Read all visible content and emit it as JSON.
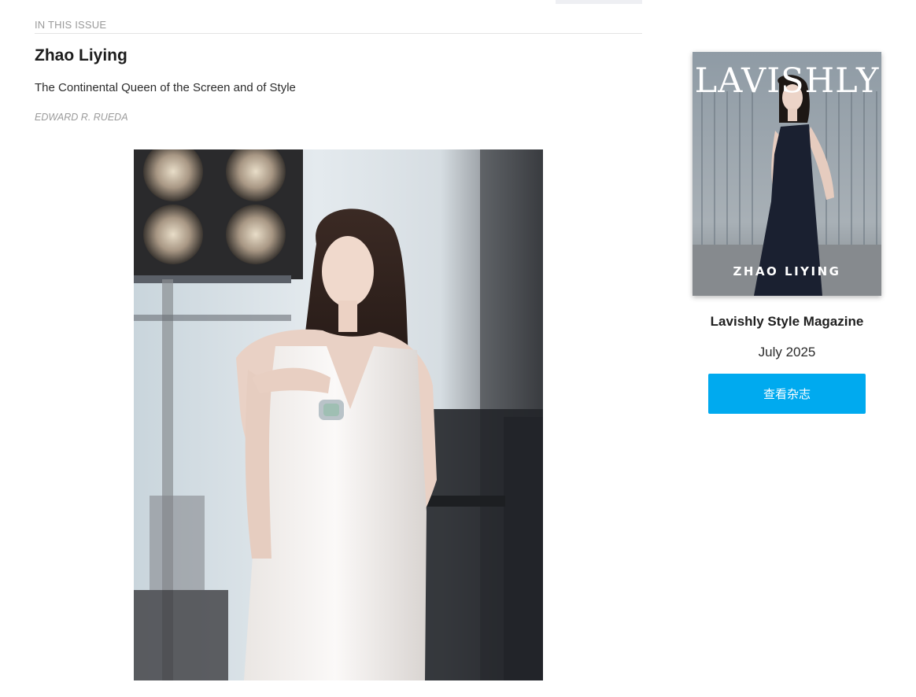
{
  "article": {
    "section_label": "IN THIS ISSUE",
    "title": "Zhao Liying",
    "subtitle": "The Continental Queen of the Screen and of Style",
    "author": "EDWARD R. RUEDA"
  },
  "sidebar": {
    "cover": {
      "masthead": "LAVISHLY",
      "cover_name": "ZHAO LIYING"
    },
    "magazine_title": "Lavishly Style Magazine",
    "issue_date": "July 2025",
    "view_button_label": "查看杂志"
  },
  "colors": {
    "button": "#00aaef",
    "section_label": "#9a9a9a"
  }
}
